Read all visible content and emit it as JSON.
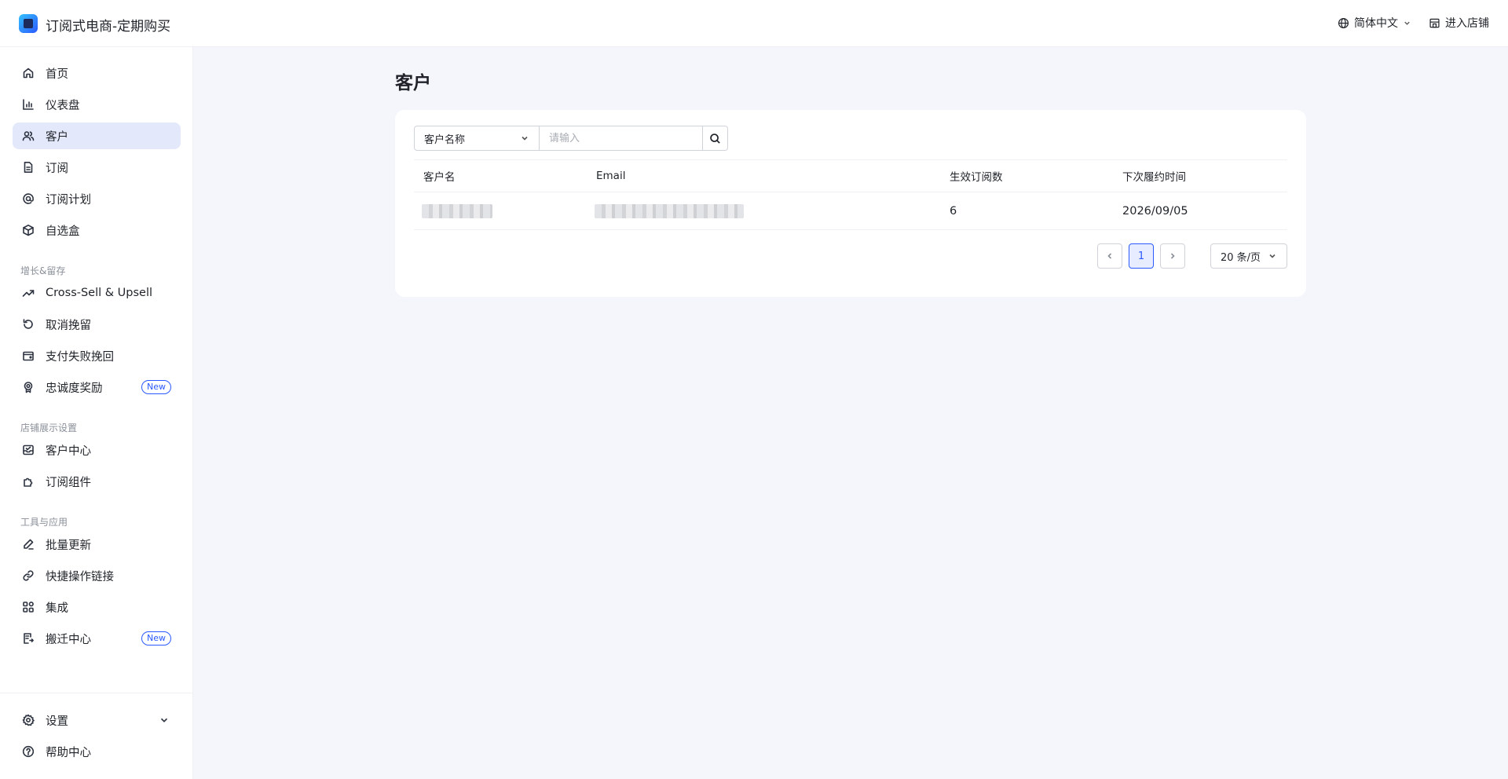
{
  "app": {
    "title": "订阅式电商-定期购买"
  },
  "header": {
    "language": "简体中文",
    "enter_store": "进入店铺"
  },
  "sidebar": {
    "items": [
      {
        "label": "首页",
        "icon": "home-icon"
      },
      {
        "label": "仪表盘",
        "icon": "bar-chart-icon"
      },
      {
        "label": "客户",
        "icon": "users-icon",
        "active": true
      },
      {
        "label": "订阅",
        "icon": "document-icon"
      },
      {
        "label": "订阅计划",
        "icon": "at-sign-icon"
      },
      {
        "label": "自选盒",
        "icon": "box-icon"
      }
    ],
    "section_growth": "增长&留存",
    "growth_items": [
      {
        "label": "Cross-Sell & Upsell",
        "icon": "trending-up-icon"
      },
      {
        "label": "取消挽留",
        "icon": "undo-icon"
      },
      {
        "label": "支付失败挽回",
        "icon": "wallet-icon"
      },
      {
        "label": "忠诚度奖励",
        "icon": "award-icon",
        "badge": "New"
      }
    ],
    "section_store": "店铺展示设置",
    "store_items": [
      {
        "label": "客户中心",
        "icon": "inbox-icon"
      },
      {
        "label": "订阅组件",
        "icon": "puzzle-icon"
      }
    ],
    "section_tools": "工具与应用",
    "tool_items": [
      {
        "label": "批量更新",
        "icon": "edit-icon"
      },
      {
        "label": "快捷操作链接",
        "icon": "link-icon"
      },
      {
        "label": "集成",
        "icon": "apps-icon"
      },
      {
        "label": "搬迁中心",
        "icon": "migrate-icon",
        "badge": "New"
      }
    ],
    "settings": "设置",
    "help": "帮助中心"
  },
  "main": {
    "title": "客户",
    "filter": {
      "field": "客户名称",
      "placeholder": "请输入"
    },
    "table": {
      "headers": [
        "客户名",
        "Email",
        "生效订阅数",
        "下次履约时间"
      ],
      "rows": [
        {
          "name": "",
          "email": "",
          "active_subscriptions": "6",
          "next_fulfillment": "2026/09/05"
        }
      ]
    },
    "pagination": {
      "current_page": "1",
      "page_size": "20 条/页"
    }
  }
}
